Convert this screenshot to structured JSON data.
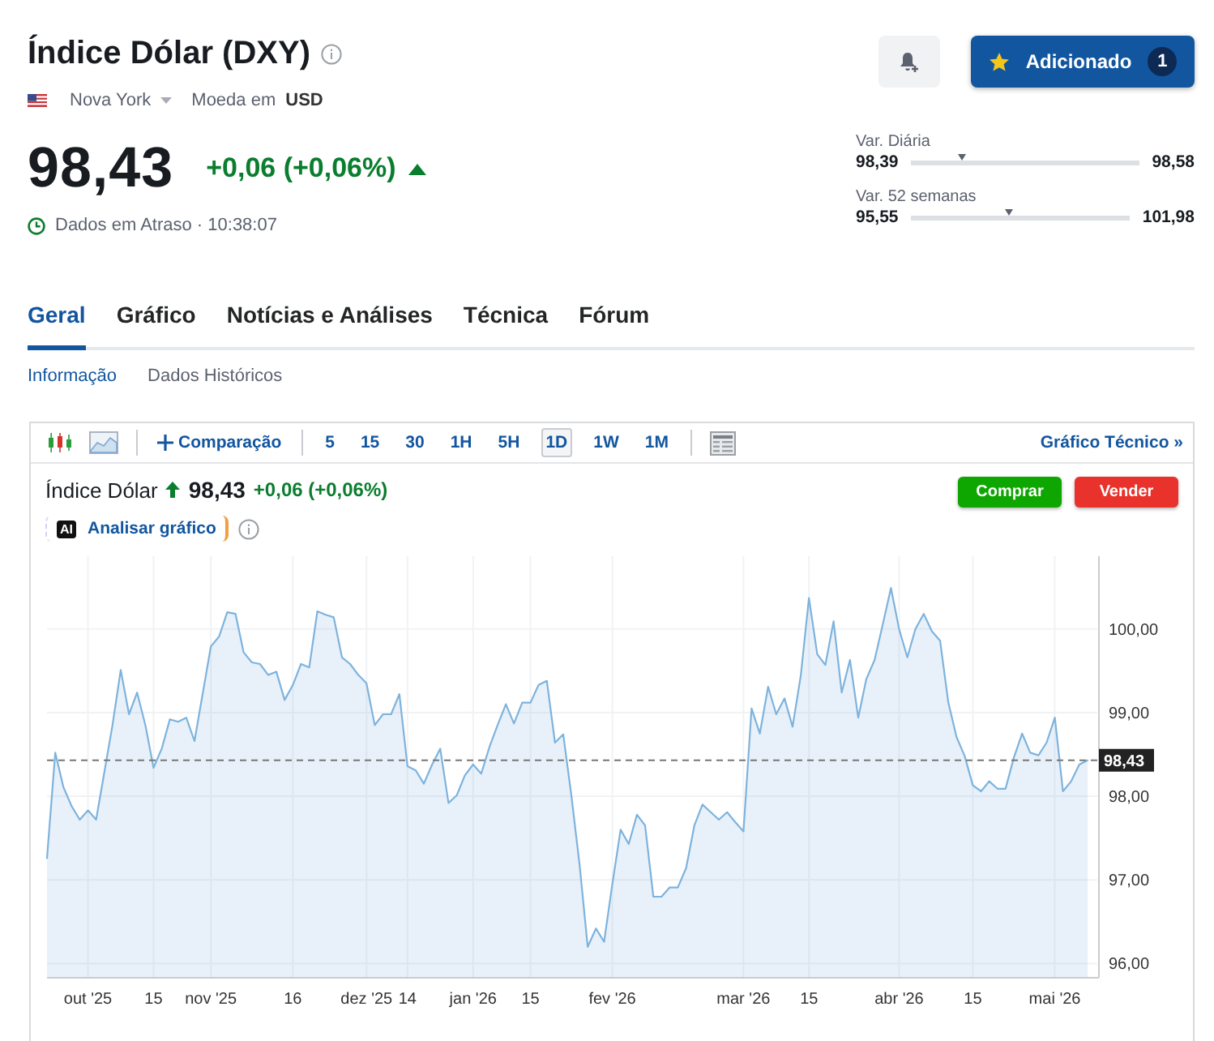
{
  "header": {
    "title": "Índice Dólar (DXY)",
    "exchange": "Nova York",
    "currency_label": "Moeda em",
    "currency": "USD",
    "price": "98,43",
    "change": "+0,06 (+0,06%)",
    "rising": true,
    "delay_status": "Dados em Atraso · 10:38:07"
  },
  "watchlist_button": {
    "label": "Adicionado",
    "count": "1"
  },
  "ranges": [
    {
      "label": "Var. Diária",
      "low": "98,39",
      "high": "98,58",
      "level": 0.22
    },
    {
      "label": "Var. 52 semanas",
      "low": "95,55",
      "high": "101,98",
      "level": 0.45
    }
  ],
  "tabs": [
    {
      "label": "Geral",
      "selected": true
    },
    {
      "label": "Gráfico",
      "selected": false
    },
    {
      "label": "Notícias e Análises",
      "selected": false
    },
    {
      "label": "Técnica",
      "selected": false
    },
    {
      "label": "Fórum",
      "selected": false
    }
  ],
  "subtabs": [
    {
      "label": "Informação",
      "selected": true
    },
    {
      "label": "Dados Históricos",
      "selected": false
    }
  ],
  "chart_toolbar": {
    "compare": "Comparação",
    "intervals": [
      {
        "label": "5",
        "selected": false
      },
      {
        "label": "15",
        "selected": false
      },
      {
        "label": "30",
        "selected": false
      },
      {
        "label": "1H",
        "selected": false
      },
      {
        "label": "5H",
        "selected": false
      },
      {
        "label": "1D",
        "selected": true
      },
      {
        "label": "1W",
        "selected": false
      },
      {
        "label": "1M",
        "selected": false
      }
    ],
    "technical_link": "Gráfico Técnico »"
  },
  "chart_legend": {
    "rising": true,
    "price": "98,43",
    "change": "+0,06 (+0,06%)",
    "ai_badge": "AI",
    "analyze": "Analisar gráfico"
  },
  "trade_buttons": [
    {
      "label": "Comprar",
      "kind": "buy"
    },
    {
      "label": "Vender",
      "kind": "sell"
    }
  ],
  "chart_data": {
    "type": "area",
    "grid": true,
    "categories": [
      null,
      null,
      null,
      null,
      null,
      "out '25",
      null,
      null,
      null,
      null,
      null,
      null,
      null,
      "15",
      null,
      null,
      null,
      null,
      null,
      null,
      "nov '25",
      null,
      null,
      null,
      null,
      null,
      null,
      null,
      null,
      null,
      "16",
      null,
      null,
      null,
      null,
      null,
      null,
      null,
      null,
      "dez '25",
      null,
      null,
      null,
      null,
      "14",
      null,
      null,
      null,
      null,
      null,
      null,
      null,
      "jan '26",
      null,
      null,
      null,
      null,
      null,
      null,
      "15",
      null,
      null,
      null,
      null,
      null,
      null,
      null,
      null,
      null,
      "fev '26",
      null,
      null,
      null,
      null,
      null,
      null,
      null,
      null,
      null,
      null,
      null,
      null,
      null,
      null,
      null,
      "mar '26",
      null,
      null,
      null,
      null,
      null,
      null,
      null,
      "15",
      null,
      null,
      null,
      null,
      null,
      null,
      null,
      null,
      null,
      null,
      "abr '26",
      null,
      null,
      null,
      null,
      null,
      null,
      null,
      null,
      "15",
      null,
      null,
      null,
      null,
      null,
      null,
      null,
      null,
      null,
      "mai '26",
      null,
      null,
      null,
      null
    ],
    "series": [
      {
        "name": "Índice Dólar",
        "color": "#7eb3dd",
        "values": [
          97.26,
          98.52,
          98.11,
          97.88,
          97.72,
          97.83,
          97.72,
          98.29,
          98.85,
          99.51,
          98.98,
          99.24,
          98.85,
          98.34,
          98.57,
          98.92,
          98.89,
          98.94,
          98.66,
          99.22,
          99.79,
          99.91,
          100.2,
          100.18,
          99.72,
          99.6,
          99.58,
          99.45,
          99.49,
          99.15,
          99.33,
          99.58,
          99.54,
          100.21,
          100.17,
          100.14,
          99.66,
          99.58,
          99.45,
          99.35,
          98.85,
          98.98,
          98.98,
          99.22,
          98.36,
          98.31,
          98.15,
          98.38,
          98.57,
          97.92,
          98.01,
          98.25,
          98.38,
          98.27,
          98.59,
          98.85,
          99.1,
          98.87,
          99.12,
          99.12,
          99.33,
          99.38,
          98.64,
          98.74,
          98.01,
          97.18,
          96.2,
          96.42,
          96.26,
          96.95,
          97.6,
          97.43,
          97.78,
          97.65,
          96.8,
          96.8,
          96.91,
          96.91,
          97.14,
          97.65,
          97.9,
          97.81,
          97.72,
          97.81,
          97.69,
          97.58,
          99.05,
          98.75,
          99.31,
          98.98,
          99.17,
          98.83,
          99.45,
          100.37,
          99.7,
          99.57,
          100.09,
          99.24,
          99.63,
          98.94,
          99.4,
          99.63,
          100.05,
          100.49,
          100,
          99.66,
          100,
          100.18,
          99.97,
          99.86,
          99.12,
          98.71,
          98.48,
          98.13,
          98.06,
          98.18,
          98.09,
          98.09,
          98.46,
          98.75,
          98.52,
          98.49,
          98.64,
          98.94,
          98.06,
          98.18,
          98.38,
          98.43
        ]
      }
    ],
    "ylim": [
      95.83,
      100.87
    ],
    "ref_lines": [
      {
        "axis": "y",
        "value": 98.43,
        "label": "98,43"
      }
    ],
    "yticks": [
      {
        "value": 96,
        "label": "96,00"
      },
      {
        "value": 97,
        "label": "97,00"
      },
      {
        "value": 98,
        "label": "98,00"
      },
      {
        "value": 99,
        "label": "99,00"
      },
      {
        "value": 100,
        "label": "100,00"
      }
    ]
  }
}
